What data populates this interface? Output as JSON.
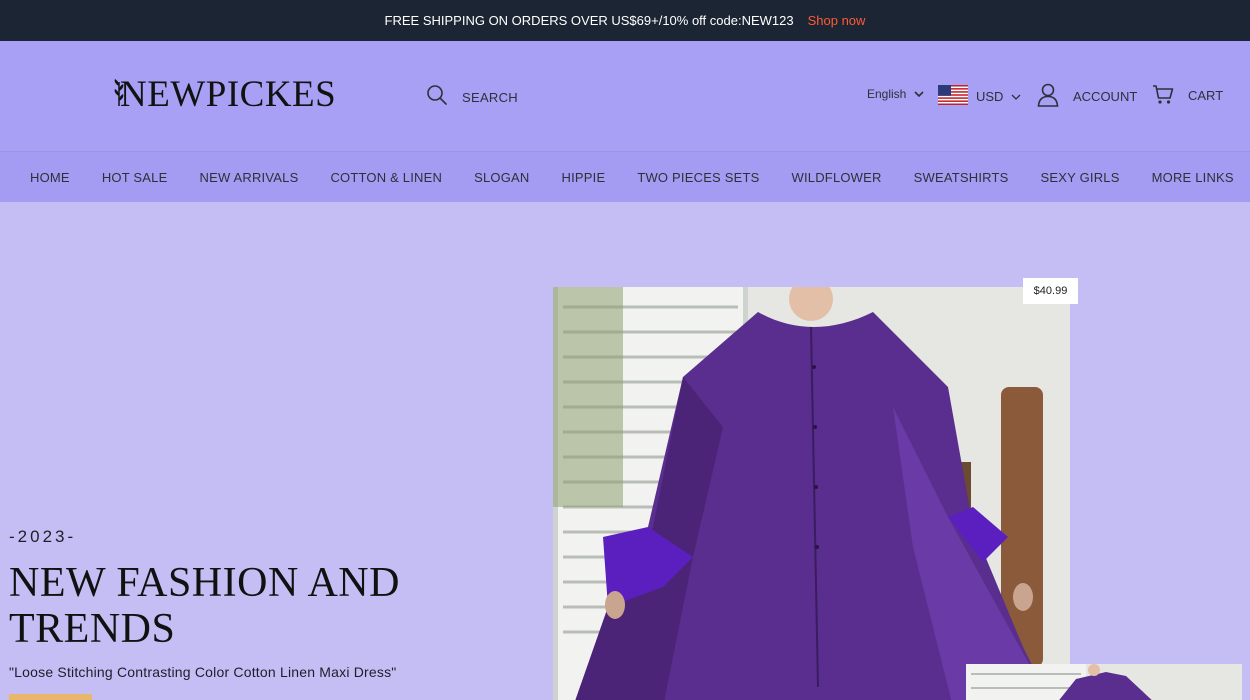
{
  "announcement": {
    "message": "FREE SHIPPING ON ORDERS OVER US$69+/10% off code:NEW123",
    "link": "Shop now"
  },
  "header": {
    "logo": "NEWPICKES",
    "search_label": "SEARCH",
    "language": "English",
    "currency": "USD",
    "account_label": "ACCOUNT",
    "cart_label": "CART"
  },
  "nav": {
    "items": [
      "HOME",
      "HOT SALE",
      "NEW ARRIVALS",
      "COTTON & LINEN",
      "SLOGAN",
      "HIPPIE",
      "TWO PIECES SETS",
      "WILDFLOWER",
      "SWEATSHIRTS",
      "SEXY GIRLS",
      "MORE LINKS"
    ]
  },
  "hero": {
    "year": "-2023-",
    "title": "NEW FASHION AND TRENDS",
    "subtitle": "\"Loose Stitching Contrasting Color Cotton Linen Maxi Dress\"",
    "price": "$40.99"
  },
  "colors": {
    "announcement_bg": "#1b2533",
    "accent_link": "#ff5b36",
    "header_bg": "#a7a0f4",
    "nav_bg": "#a39cf2",
    "hero_bg": "#c4bef5",
    "button": "#e7b86b"
  },
  "icons": {
    "search": "search-icon",
    "flag": "us-flag-icon",
    "account": "user-icon",
    "cart": "cart-icon"
  }
}
